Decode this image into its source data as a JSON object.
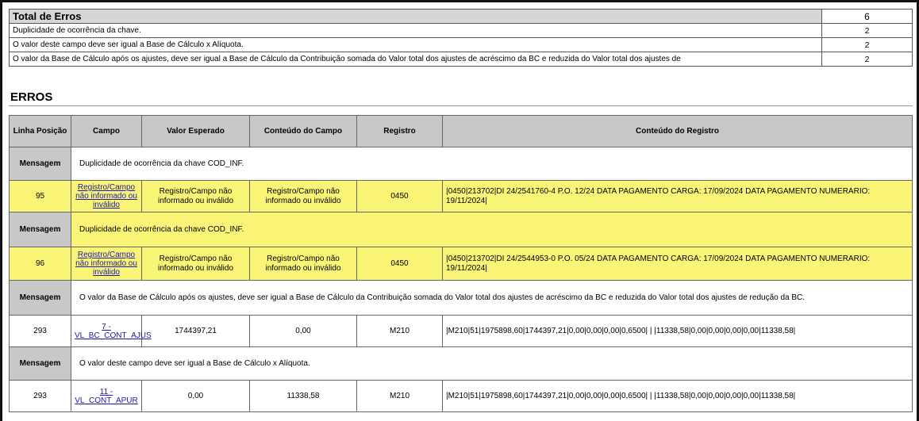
{
  "summary": {
    "title": "Total de Erros",
    "total": "6",
    "rows": [
      {
        "text": "Duplicidade de ocorrência da chave.",
        "count": "2"
      },
      {
        "text": "O valor deste campo deve ser igual a Base de Cálculo x Alíquota.",
        "count": "2"
      },
      {
        "text": "O valor da Base de Cálculo após os ajustes, deve ser igual a Base de Cálculo da Contribuição somada do Valor total dos ajustes de acréscimo da BC e reduzida do Valor total dos ajustes de",
        "count": "2"
      }
    ]
  },
  "errors_title": "ERROS",
  "columns": {
    "linha": "Linha Posição",
    "campo": "Campo",
    "valor": "Valor Esperado",
    "conteudo": "Conteúdo do Campo",
    "registro": "Registro",
    "conteudo_registro": "Conteúdo do Registro"
  },
  "message_label": "Mensagem",
  "groups": [
    {
      "message": "Duplicidade de ocorrência da chave COD_INF.",
      "row": {
        "linha": "95",
        "campo": "Registro/Campo não informado ou inválido",
        "valor": "Registro/Campo não informado ou inválido",
        "conteudo": "Registro/Campo não informado ou inválido",
        "registro": "0450",
        "conteudo_registro": "|0450|213702|DI 24/2541760-4 P.O. 12/24  DATA PAGAMENTO CARGA: 17/09/2024 DATA PAGAMENTO NUMERARIO: 19/11/2024|"
      }
    },
    {
      "message": "Duplicidade de ocorrência da chave COD_INF.",
      "row": {
        "linha": "96",
        "campo": "Registro/Campo não informado ou inválido",
        "valor": "Registro/Campo não informado ou inválido",
        "conteudo": "Registro/Campo não informado ou inválido",
        "registro": "0450",
        "conteudo_registro": "|0450|213702|DI 24/2544953-0 P.O. 05/24  DATA PAGAMENTO CARGA: 17/09/2024 DATA PAGAMENTO NUMERARIO: 19/11/2024|"
      }
    },
    {
      "message": "O valor da Base de Cálculo após os ajustes, deve ser igual a Base de Cálculo da Contribuição somada do Valor total dos ajustes de acréscimo da BC e reduzida do Valor total dos ajustes de redução da BC.",
      "row": {
        "linha": "293",
        "campo": "7 - VL_BC_CONT_AJUS",
        "valor": "1744397,21",
        "conteudo": "0,00",
        "registro": "M210",
        "conteudo_registro": "|M210|51|1975898,60|1744397,21|0,00|0,00|0,00|0,6500| | |11338,58|0,00|0,00|0,00|0,00|11338,58|"
      }
    },
    {
      "message": "O valor deste campo deve ser igual a Base de Cálculo x Alíquota.",
      "row": {
        "linha": "293",
        "campo": "11 - VL_CONT_APUR",
        "valor": "0,00",
        "conteudo": "11338,58",
        "registro": "M210",
        "conteudo_registro": "|M210|51|1975898,60|1744397,21|0,00|0,00|0,00|0,6500| | |11338,58|0,00|0,00|0,00|0,00|11338,58|"
      }
    }
  ],
  "colors": {
    "highlight": "#fbf577",
    "header_gray": "#c8c8c8",
    "link": "#1a1aa8"
  }
}
